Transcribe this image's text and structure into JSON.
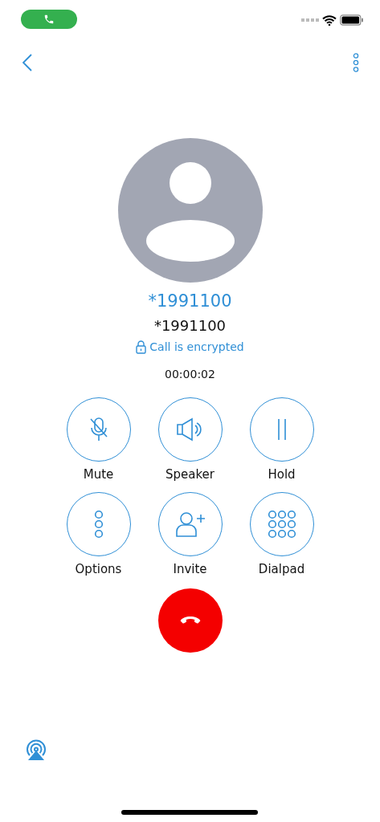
{
  "contact": {
    "name": "*1991100",
    "number": "*1991100",
    "security": "Call is encrypted",
    "duration": "00:00:02"
  },
  "actions": [
    {
      "kind": "mute",
      "label": "Mute"
    },
    {
      "kind": "speaker",
      "label": "Speaker"
    },
    {
      "kind": "hold",
      "label": "Hold"
    },
    {
      "kind": "options",
      "label": "Options"
    },
    {
      "kind": "invite",
      "label": "Invite"
    },
    {
      "kind": "dialpad",
      "label": "Dialpad"
    }
  ]
}
